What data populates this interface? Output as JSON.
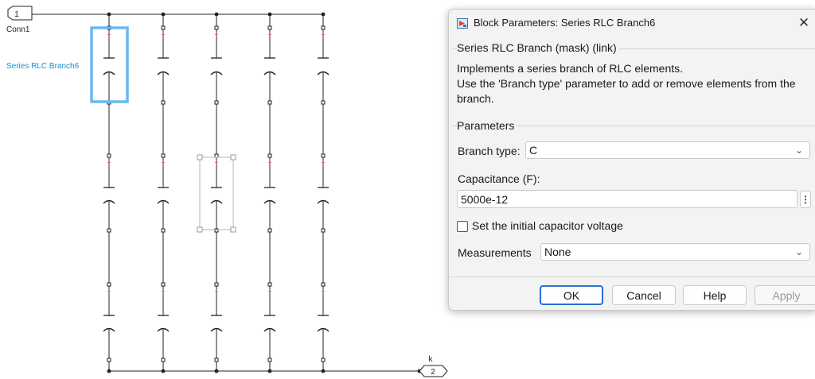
{
  "canvas": {
    "in_port": {
      "number": "1",
      "label": "Conn1"
    },
    "out_port": {
      "number": "2",
      "label": "k"
    },
    "selected_block_name": "Series RLC Branch6"
  },
  "dialog": {
    "title": "Block Parameters: Series RLC Branch6",
    "close_glyph": "✕",
    "block_heading": "Series RLC Branch (mask) (link)",
    "description_line1": "Implements a series branch of RLC elements.",
    "description_line2": "Use the 'Branch type' parameter to add or remove elements from the branch.",
    "parameters_heading": "Parameters",
    "branch_type": {
      "label": "Branch type:",
      "value": "C"
    },
    "capacitance": {
      "label": "Capacitance (F):",
      "value": "5000e-12"
    },
    "initial_voltage": {
      "label": "Set the initial capacitor voltage",
      "checked": false
    },
    "measurements": {
      "label": "Measurements",
      "value": "None"
    },
    "buttons": {
      "ok": "OK",
      "cancel": "Cancel",
      "help": "Help",
      "apply": "Apply"
    }
  }
}
